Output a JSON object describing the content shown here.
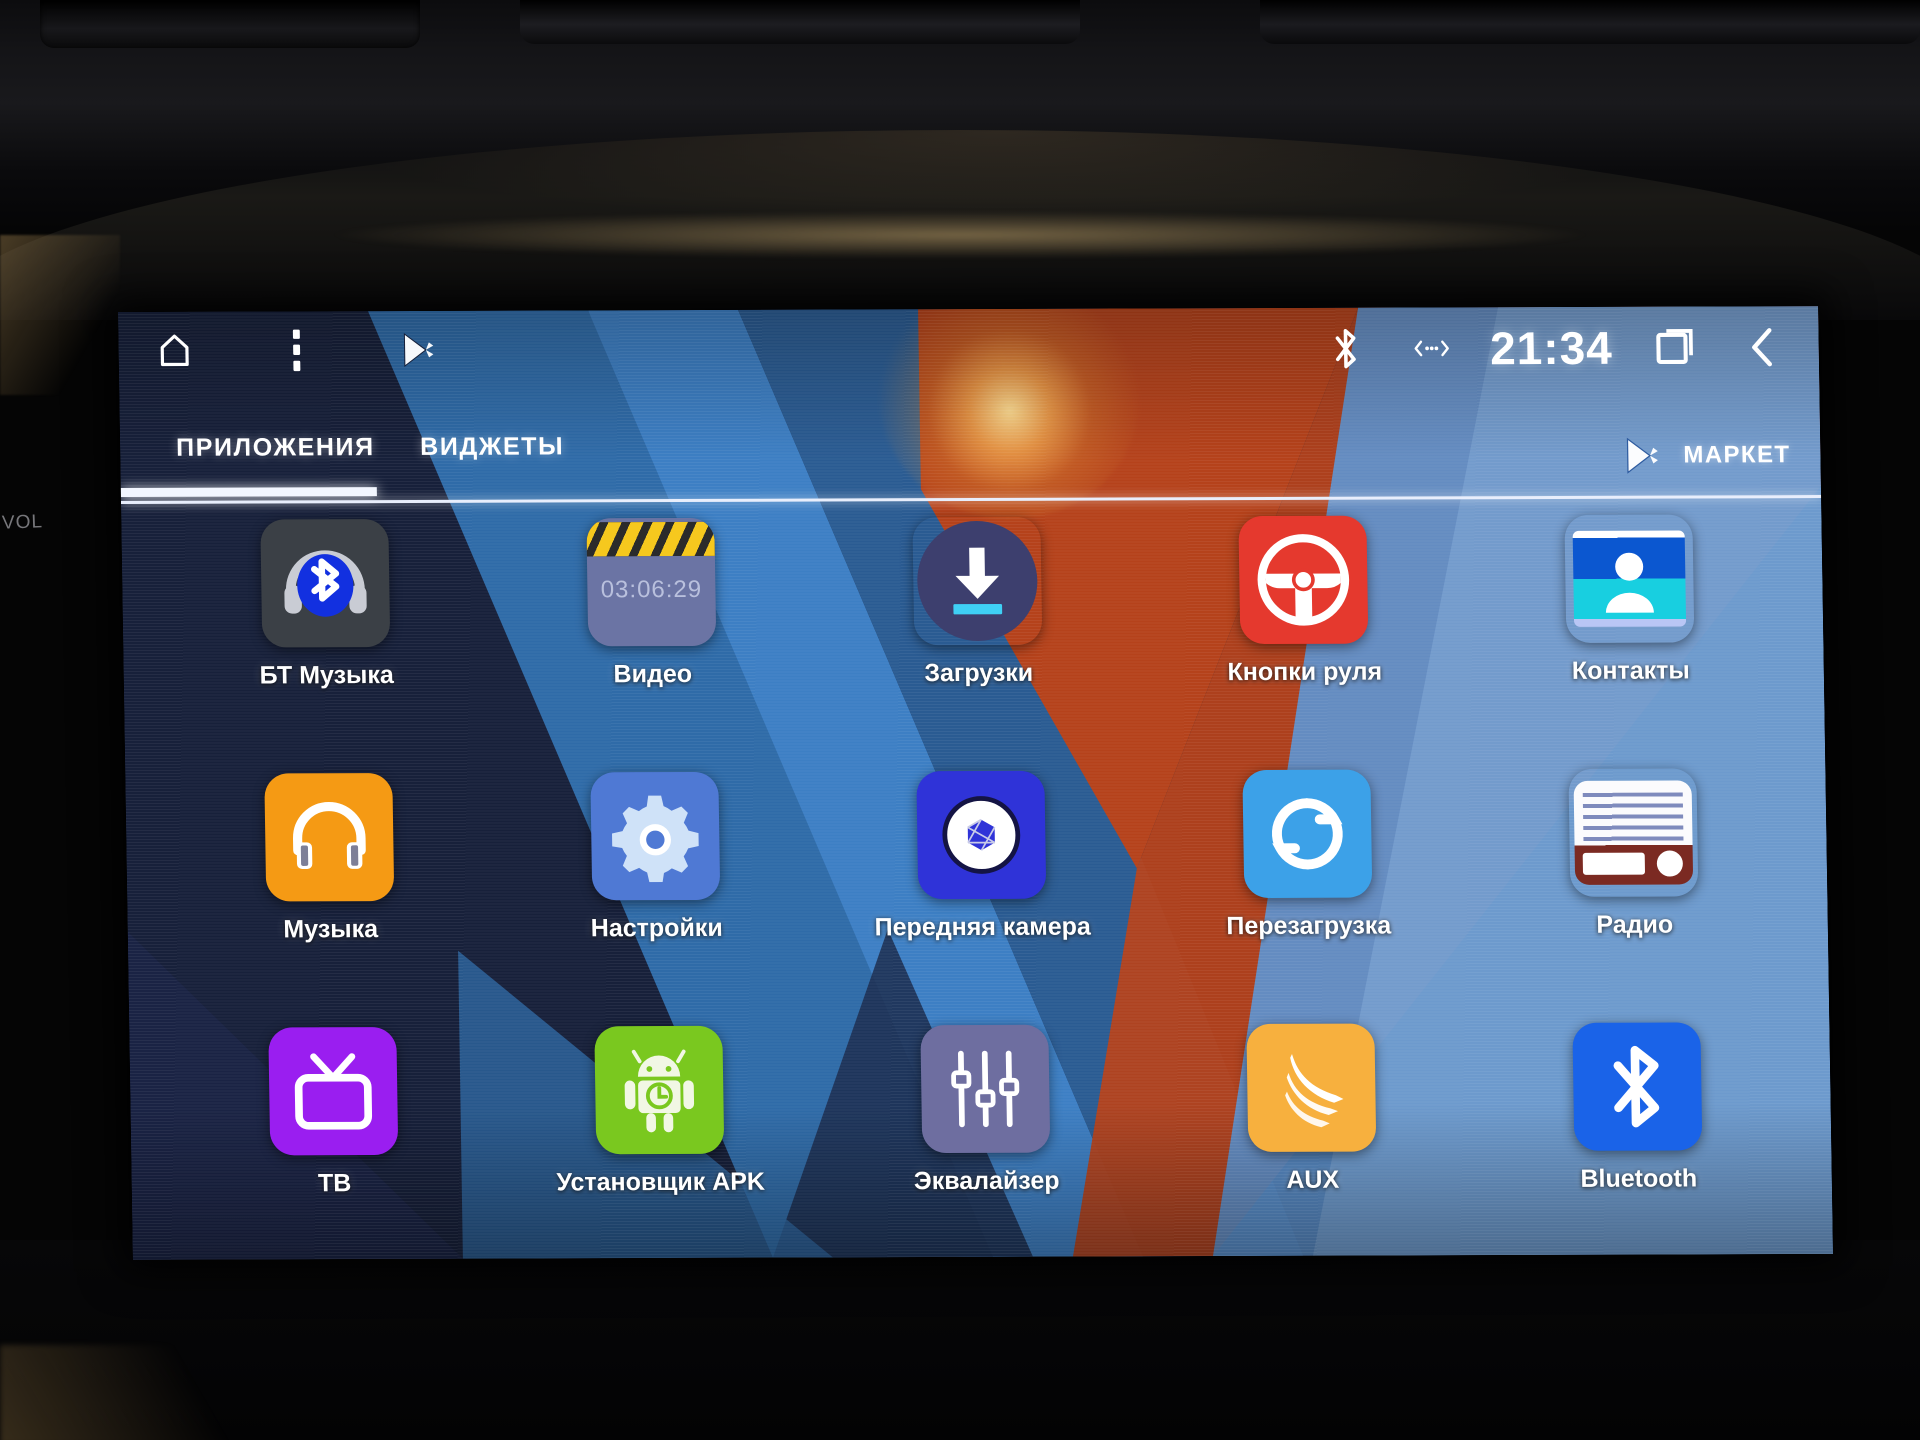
{
  "device": {
    "bezel_label": "VOL"
  },
  "statusbar": {
    "left_icons": [
      {
        "name": "home-icon",
        "glyph": "home"
      },
      {
        "name": "overflow-menu-icon",
        "glyph": "dots-vertical"
      },
      {
        "name": "play-store-icon",
        "glyph": "play"
      }
    ],
    "bluetooth_icon": "bluetooth-icon",
    "usb_icon": "usb-transfer-icon",
    "clock": "21:34",
    "recents_icon": "recent-apps-icon",
    "back_icon": "back-chevron-icon"
  },
  "tabs": {
    "apps": "ПРИЛОЖЕНИЯ",
    "widgets": "ВИДЖЕТЫ",
    "active": "apps",
    "market_label": "МАРКЕТ",
    "market_icon": "play-store-icon"
  },
  "apps": [
    {
      "label": "БТ Музыка",
      "icon": "bluetooth-headphones-icon",
      "icon_class": "ic-btmusic"
    },
    {
      "label": "Видео",
      "icon": "clapperboard-icon",
      "icon_class": "ic-video",
      "overlay_time": "03:06:29"
    },
    {
      "label": "Загрузки",
      "icon": "download-arrow-icon",
      "icon_class": "ic-dl"
    },
    {
      "label": "Кнопки руля",
      "icon": "steering-wheel-icon",
      "icon_class": "ic-wheel"
    },
    {
      "label": "Контакты",
      "icon": "contact-card-icon",
      "icon_class": "ic-contacts"
    },
    {
      "label": "Музыка",
      "icon": "headphones-icon",
      "icon_class": "ic-music"
    },
    {
      "label": "Настройки",
      "icon": "gear-icon",
      "icon_class": "ic-settings"
    },
    {
      "label": "Передняя камера",
      "icon": "camera-aperture-icon",
      "icon_class": "ic-camera"
    },
    {
      "label": "Перезагрузка",
      "icon": "refresh-sync-icon",
      "icon_class": "ic-reboot"
    },
    {
      "label": "Радио",
      "icon": "retro-radio-icon",
      "icon_class": "ic-radio"
    },
    {
      "label": "ТВ",
      "icon": "television-icon",
      "icon_class": "ic-tv"
    },
    {
      "label": "Установщик APK",
      "icon": "android-robot-icon",
      "icon_class": "ic-apk"
    },
    {
      "label": "Эквалайзер",
      "icon": "equalizer-sliders-icon",
      "icon_class": "ic-eq"
    },
    {
      "label": "AUX",
      "icon": "aux-cable-icon",
      "icon_class": "ic-aux"
    },
    {
      "label": "Bluetooth",
      "icon": "bluetooth-icon",
      "icon_class": "ic-bt"
    }
  ],
  "colors": {
    "accent_white": "#ffffff",
    "wallpaper_dark_blue": "#17203a",
    "wallpaper_blue": "#3d7fc4",
    "wallpaper_orange": "#b5421b",
    "red": "#e5392e",
    "orange": "#f59a14",
    "green": "#7ac81f",
    "purple": "#9a1ef0",
    "bt_blue": "#1a63e8"
  }
}
